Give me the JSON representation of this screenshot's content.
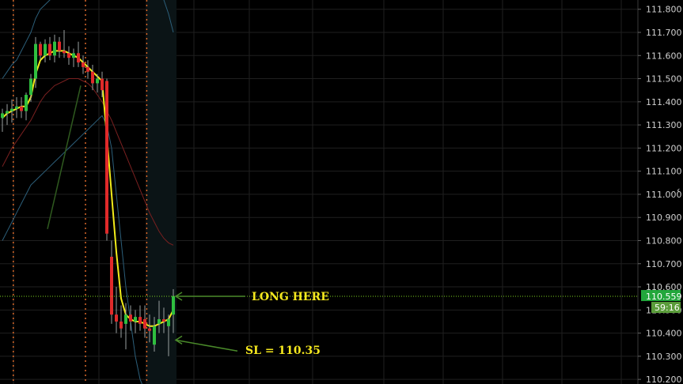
{
  "colors": {
    "background": "#000000",
    "grid": "#1f1f1f",
    "bull": "#2fbf3f",
    "bear": "#e02a2a",
    "wick": "#9aa0a0",
    "sma_fast": "#f2ec1a",
    "sma_slow": "#7a2020",
    "bollinger": "#2c5f7a",
    "session_line": "#d9692a",
    "level_line": "#7ed321",
    "annotation": "#f5e81e",
    "arrow": "#4a8a2a",
    "trend": "#2f5a1f",
    "price_badge": "#22a73c",
    "timer_badge": "#5a9c3a"
  },
  "price_axis": {
    "labels": [
      "111.800",
      "111.700",
      "111.600",
      "111.500",
      "111.400",
      "111.300",
      "111.200",
      "111.100",
      "111.000",
      "110.900",
      "110.800",
      "110.700",
      "110.600",
      "110.500",
      "110.400",
      "110.300",
      "110.200"
    ],
    "range": [
      110.18,
      111.84
    ]
  },
  "badges": {
    "current_price": "110.559",
    "countdown": "59:16"
  },
  "annotations": {
    "entry": "LONG HERE",
    "stop": "SL = 110.35"
  },
  "chart_data": {
    "type": "candlestick",
    "ylim": [
      110.18,
      111.84
    ],
    "entry_level": 110.559,
    "stop_level": 110.35,
    "candles": [
      {
        "o": 111.33,
        "h": 111.37,
        "l": 111.27,
        "c": 111.35
      },
      {
        "o": 111.35,
        "h": 111.39,
        "l": 111.3,
        "c": 111.36
      },
      {
        "o": 111.36,
        "h": 111.41,
        "l": 111.31,
        "c": 111.37
      },
      {
        "o": 111.37,
        "h": 111.42,
        "l": 111.33,
        "c": 111.38
      },
      {
        "o": 111.38,
        "h": 111.42,
        "l": 111.33,
        "c": 111.36
      },
      {
        "o": 111.36,
        "h": 111.44,
        "l": 111.32,
        "c": 111.43
      },
      {
        "o": 111.43,
        "h": 111.52,
        "l": 111.4,
        "c": 111.5
      },
      {
        "o": 111.5,
        "h": 111.68,
        "l": 111.46,
        "c": 111.65
      },
      {
        "o": 111.65,
        "h": 111.66,
        "l": 111.58,
        "c": 111.6
      },
      {
        "o": 111.6,
        "h": 111.67,
        "l": 111.57,
        "c": 111.65
      },
      {
        "o": 111.65,
        "h": 111.68,
        "l": 111.58,
        "c": 111.6
      },
      {
        "o": 111.6,
        "h": 111.69,
        "l": 111.57,
        "c": 111.66
      },
      {
        "o": 111.66,
        "h": 111.68,
        "l": 111.59,
        "c": 111.62
      },
      {
        "o": 111.62,
        "h": 111.71,
        "l": 111.59,
        "c": 111.61
      },
      {
        "o": 111.61,
        "h": 111.64,
        "l": 111.56,
        "c": 111.59
      },
      {
        "o": 111.59,
        "h": 111.63,
        "l": 111.55,
        "c": 111.61
      },
      {
        "o": 111.61,
        "h": 111.66,
        "l": 111.55,
        "c": 111.57
      },
      {
        "o": 111.57,
        "h": 111.6,
        "l": 111.52,
        "c": 111.55
      },
      {
        "o": 111.55,
        "h": 111.58,
        "l": 111.5,
        "c": 111.53
      },
      {
        "o": 111.53,
        "h": 111.56,
        "l": 111.45,
        "c": 111.48
      },
      {
        "o": 111.48,
        "h": 111.52,
        "l": 111.44,
        "c": 111.5
      },
      {
        "o": 111.5,
        "h": 111.53,
        "l": 111.42,
        "c": 111.45
      },
      {
        "o": 111.49,
        "h": 111.5,
        "l": 110.8,
        "c": 110.83
      },
      {
        "o": 110.73,
        "h": 110.8,
        "l": 110.44,
        "c": 110.48
      },
      {
        "o": 110.48,
        "h": 110.6,
        "l": 110.4,
        "c": 110.45
      },
      {
        "o": 110.45,
        "h": 110.52,
        "l": 110.38,
        "c": 110.42
      },
      {
        "o": 110.44,
        "h": 110.53,
        "l": 110.33,
        "c": 110.48
      },
      {
        "o": 110.48,
        "h": 110.52,
        "l": 110.41,
        "c": 110.45
      },
      {
        "o": 110.45,
        "h": 110.5,
        "l": 110.4,
        "c": 110.47
      },
      {
        "o": 110.47,
        "h": 110.52,
        "l": 110.41,
        "c": 110.44
      },
      {
        "o": 110.46,
        "h": 110.52,
        "l": 110.38,
        "c": 110.42
      },
      {
        "o": 110.42,
        "h": 110.48,
        "l": 110.36,
        "c": 110.41
      },
      {
        "o": 110.35,
        "h": 110.47,
        "l": 110.32,
        "c": 110.43
      },
      {
        "o": 110.44,
        "h": 110.54,
        "l": 110.4,
        "c": 110.46
      },
      {
        "o": 110.46,
        "h": 110.51,
        "l": 110.4,
        "c": 110.45
      },
      {
        "o": 110.43,
        "h": 110.48,
        "l": 110.3,
        "c": 110.46
      },
      {
        "o": 110.48,
        "h": 110.59,
        "l": 110.4,
        "c": 110.56
      }
    ],
    "sma_fast": [
      111.33,
      111.35,
      111.36,
      111.37,
      111.38,
      111.38,
      111.42,
      111.52,
      111.58,
      111.6,
      111.61,
      111.62,
      111.62,
      111.62,
      111.61,
      111.6,
      111.59,
      111.57,
      111.55,
      111.53,
      111.51,
      111.49,
      111.25,
      111.0,
      110.75,
      110.55,
      110.48,
      110.46,
      110.45,
      110.45,
      110.44,
      110.43,
      110.43,
      110.44,
      110.45,
      110.46,
      110.5
    ],
    "sma_slow": [
      111.12,
      111.16,
      111.2,
      111.23,
      111.26,
      111.29,
      111.32,
      111.36,
      111.4,
      111.43,
      111.45,
      111.47,
      111.48,
      111.49,
      111.5,
      111.5,
      111.5,
      111.49,
      111.48,
      111.46,
      111.43,
      111.4,
      111.36,
      111.32,
      111.27,
      111.22,
      111.17,
      111.12,
      111.07,
      111.02,
      110.97,
      110.92,
      110.88,
      110.84,
      110.81,
      110.79,
      110.78
    ],
    "bollinger_upper": [
      111.5,
      111.53,
      111.56,
      111.58,
      111.62,
      111.66,
      111.7,
      111.76,
      111.8,
      111.82,
      111.84,
      111.86,
      111.88,
      111.88,
      111.88,
      111.88,
      111.88,
      111.88,
      111.88,
      111.88,
      111.88,
      111.88,
      111.88,
      111.88,
      111.88,
      111.88,
      111.88,
      111.88,
      111.88,
      111.88,
      111.88,
      111.88,
      111.88,
      111.88,
      111.84,
      111.78,
      111.7
    ],
    "bollinger_lower": [
      110.8,
      110.84,
      110.88,
      110.92,
      110.96,
      111.0,
      111.04,
      111.06,
      111.08,
      111.1,
      111.12,
      111.14,
      111.16,
      111.18,
      111.2,
      111.22,
      111.24,
      111.26,
      111.28,
      111.3,
      111.32,
      111.34,
      111.3,
      111.2,
      111.0,
      110.8,
      110.6,
      110.45,
      110.3,
      110.2,
      110.15,
      110.12,
      110.1,
      110.1,
      110.1,
      110.12,
      110.15
    ]
  }
}
